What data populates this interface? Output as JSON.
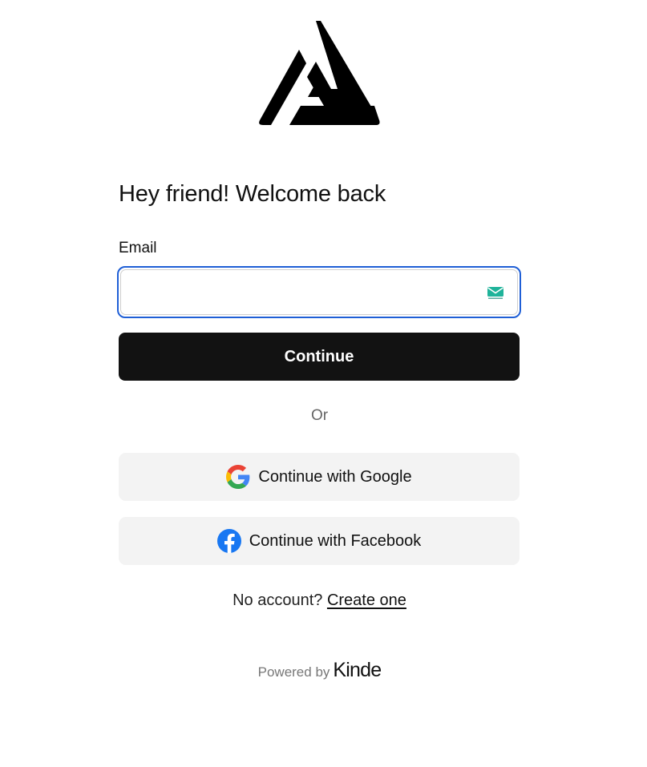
{
  "logo": {
    "icon": "triangle-a-logo"
  },
  "heading": "Hey friend! Welcome back",
  "email": {
    "label": "Email",
    "value": "",
    "placeholder": "",
    "extension_icon": "tempmail-icon"
  },
  "continue_button": "Continue",
  "divider_text": "Or",
  "social": {
    "google": {
      "label": "Continue with Google",
      "icon": "google-icon"
    },
    "facebook": {
      "label": "Continue with Facebook",
      "icon": "facebook-icon"
    }
  },
  "signup": {
    "prompt": "No account?",
    "link_text": "Create one"
  },
  "footer": {
    "powered_by": "Powered by",
    "brand": "Kinde"
  },
  "colors": {
    "primary_button": "#121212",
    "focus_ring": "#1f5fd6",
    "social_button_bg": "#f3f3f3",
    "facebook_blue": "#1877f2"
  }
}
